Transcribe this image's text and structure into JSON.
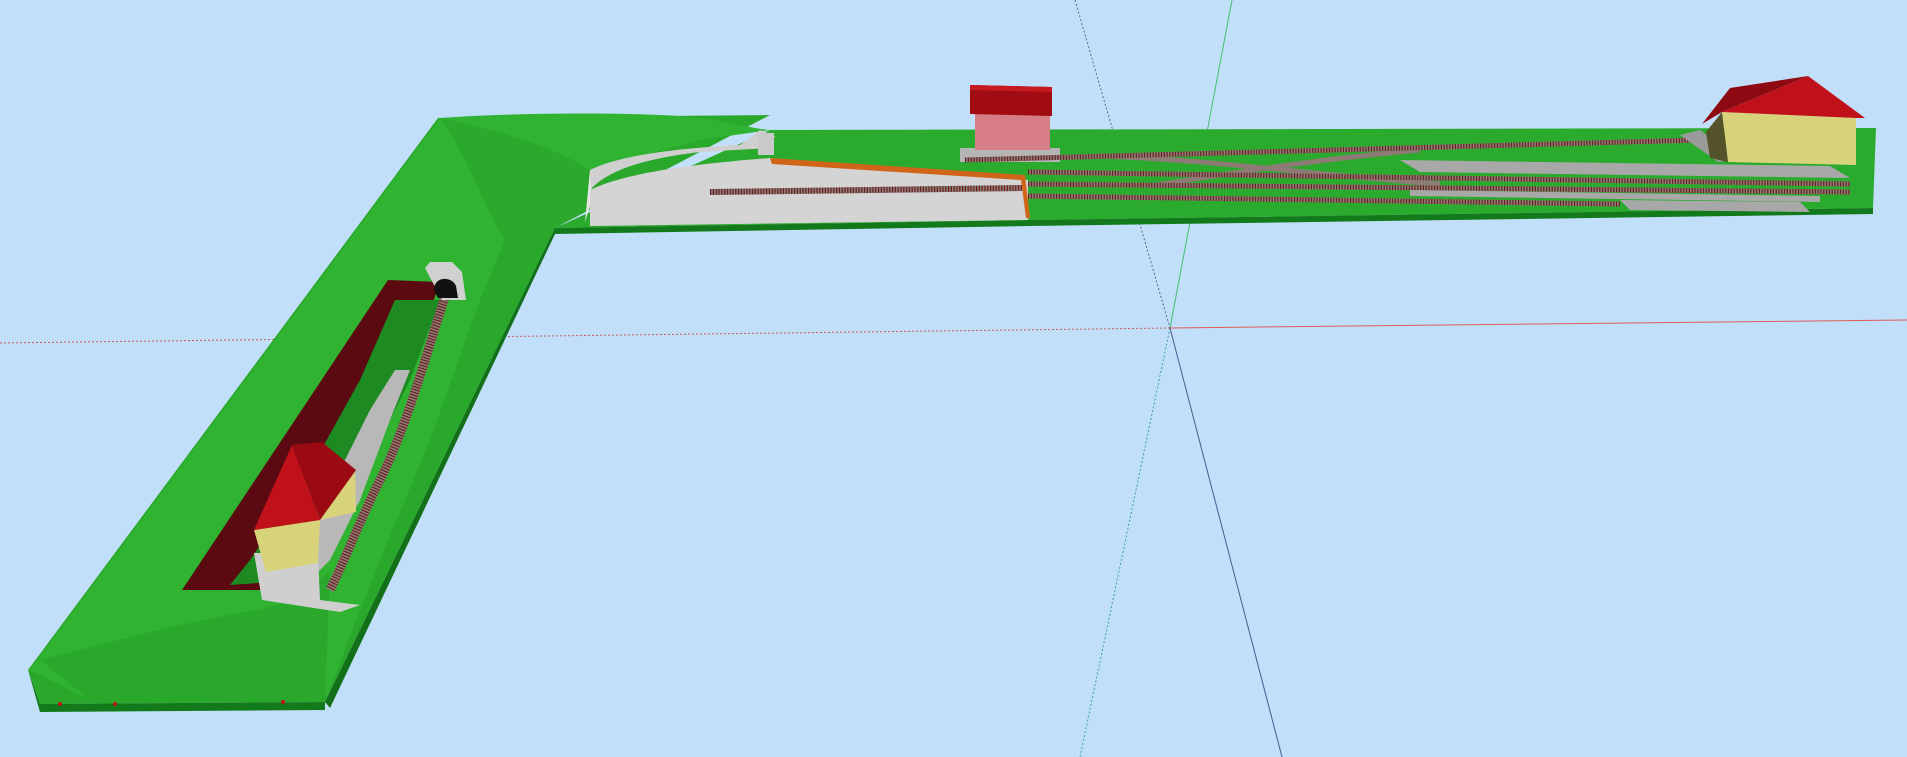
{
  "app": {
    "title": ""
  },
  "viewport": {
    "background_color": "#c2dff9",
    "camera": "perspective",
    "axes_visible": true,
    "axis_colors": {
      "red_axis": "#e05a5a",
      "green_axis": "#3fc06b",
      "blue_axis": "#4a5a8a"
    }
  },
  "scene": {
    "description_label": "",
    "baseboard_color": "#1e9a2a",
    "terrain_color": "#22a52a",
    "station_building_roof_color": "#9b0a12",
    "station_building_wall_color": "#d8d37a",
    "goods_shed_roof_color": "#a00c12",
    "goods_shed_wall_color": "#d77d85",
    "platform_color": "#c9c9c9",
    "rock_face_color": "#5a0a10",
    "track_ballast_color": "#9a8b86",
    "objects": [
      "baseboard",
      "terrain",
      "tunnel-portal",
      "tunnel-cutting",
      "curved-track",
      "left-station-building",
      "retaining-wall",
      "harbour-platform",
      "goods-shed",
      "station-yard-tracks",
      "right-station-building",
      "loading-platforms"
    ]
  }
}
